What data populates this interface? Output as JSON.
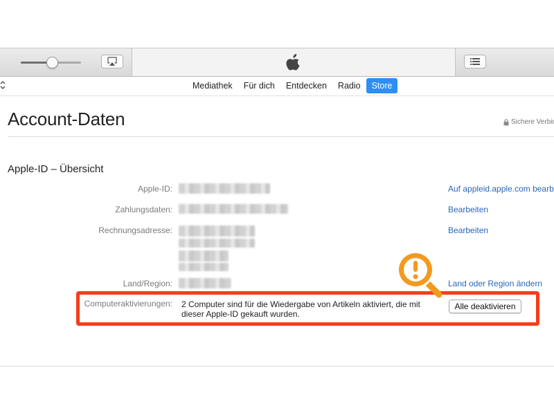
{
  "nav": {
    "tabs": [
      {
        "label": "Mediathek"
      },
      {
        "label": "Für dich"
      },
      {
        "label": "Entdecken"
      },
      {
        "label": "Radio"
      },
      {
        "label": "Store",
        "active": true
      }
    ]
  },
  "page": {
    "title": "Account-Daten",
    "secure_text": "Sichere Verbin"
  },
  "overview": {
    "heading": "Apple-ID – Übersicht",
    "rows": {
      "apple_id": {
        "label": "Apple-ID:",
        "action": "Auf appleid.apple.com bearb."
      },
      "payment": {
        "label": "Zahlungsdaten:",
        "action": "Bearbeiten"
      },
      "billing": {
        "label": "Rechnungsadresse:",
        "action": "Bearbeiten"
      },
      "country": {
        "label": "Land/Region:",
        "action": "Land oder Region ändern"
      }
    },
    "activations": {
      "label": "Computeraktivierungen:",
      "text": "2 Computer sind für die Wiedergabe von Artikeln aktiviert, die mit dieser Apple-ID gekauft wurden.",
      "button": "Alle deaktivieren"
    }
  },
  "toolbar": {
    "volume_level": 0.52,
    "icons": [
      "airplay-icon",
      "apple-logo-icon",
      "up-next-list-icon"
    ]
  },
  "colors": {
    "accent": "#2e8ef4",
    "link": "#2867b8",
    "highlight": "#f53d1b",
    "badge": "#f39a1e"
  }
}
